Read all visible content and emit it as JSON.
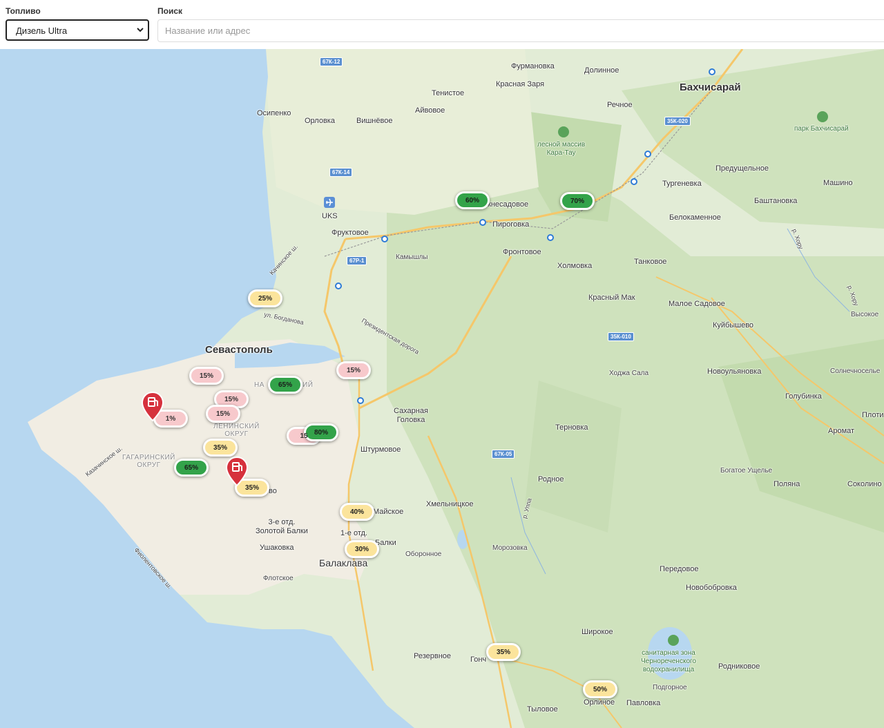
{
  "filters": {
    "fuel_label": "Топливо",
    "fuel_value": "Дизель Ultra",
    "search_label": "Поиск",
    "search_placeholder": "Название или адрес"
  },
  "map": {
    "places": {
      "furmanovka": "Фурмановка",
      "dolinnoe": "Долинное",
      "bakhchisaray": "Бахчисарай",
      "krasnaya_zarya": "Красная Заря",
      "tenistoe": "Тенистое",
      "rechnoe": "Речное",
      "osipenko": "Осипенко",
      "orlovka": "Орловка",
      "vishnevoe": "Вишнёвое",
      "aivovoe": "Айвовое",
      "park_bakhchisaray": "парк Бахчисарай",
      "kara_tau": "лесной массив\nКара-Тау",
      "predushchelnoe": "Предущельное",
      "turgenevka": "Тургеневка",
      "mashino": "Машино",
      "bashtanovka": "Баштановка",
      "uks": "UKS",
      "nesadovoe": "кнесадовое",
      "pirogovka": "Пироговка",
      "belokamennoe": "Белокаменное",
      "fruktovoe": "Фруктовое",
      "kamyshly": "Камышлы",
      "frontovoe": "Фронтовое",
      "kholmovka": "Холмовка",
      "tankovoe": "Танковое",
      "kachinskoe": "Качинское ш.",
      "krasny_mak": "Красный Мак",
      "maloe_sadovoe": "Малое Садовое",
      "vysokoe": "Высокое",
      "kuibyshevo": "Куйбышево",
      "bogdanova": "ул. Богданова",
      "prezidentskaya": "Президентская дорога",
      "sevastopol": "Севастополь",
      "khodzha_sala": "Ходжа Сала",
      "novoulyanovka": "Новоульяновка",
      "solnechnoselye": "Солнечноселье",
      "golubinka": "Голубинка",
      "plotinnoe": "Плоти",
      "sakharnaya": "Сахарная\nГоловка",
      "leninsky": "ЛЕНИНСКИЙ\nОКРУГ",
      "ternovka": "Терновка",
      "aromat": "Аромат",
      "shturmovoe": "Штурмовое",
      "gagarinsky": "ГАГАРИНСКИЙ\nОКРУГ",
      "kazachinskoe": "Казачинское ш.",
      "rodnoe": "Родное",
      "bogatoe_ushchelye": "Богатое Ущелье",
      "polyana": "Поляна",
      "sokolinoe": "Соколино",
      "khmelnitskoe": "Хмельницкое",
      "maiskoe": "Майское",
      "zolotoy_balki3": "3-е отд.\nЗолотой Балки",
      "otd1": "1-е отд.",
      "balki": "Балки",
      "ushakovka": "Ушаковка",
      "oboronnoe": "Оборонное",
      "morozovka": "Морозовка",
      "balaklava": "Балаклава",
      "flotskoe": "Флотское",
      "fiolentovskoe": "Фиолентовское ш.",
      "peredovoe": "Передовое",
      "novobobrovka": "Новобобровка",
      "shirokoe": "Широкое",
      "chernorech": "санитарная зона\nЧернореченского\nводохранилища",
      "rodnikovoe": "Родниковое",
      "rezervnoe": "Резервное",
      "gonchar": "Гонч",
      "podgornoe": "Подгорное",
      "orlinoe": "Орлиное",
      "pavlovka": "Павловка",
      "tylovoe": "Тыловое",
      "uppa": "р. Уппа",
      "khoru": "р. Хору",
      "khoru2": "р. Хору",
      "na": "НА",
      "iy": "ИЙ",
      "vo": "во"
    },
    "routes": {
      "r1": "67К-12",
      "r2": "67К-14",
      "r3": "67Р-1",
      "r4": "35К-020",
      "r5": "35К-010",
      "r6": "67К-05"
    },
    "badges": [
      {
        "label": "60%",
        "color": "green"
      },
      {
        "label": "70%",
        "color": "green"
      },
      {
        "label": "25%",
        "color": "yellow"
      },
      {
        "label": "15%",
        "color": "red"
      },
      {
        "label": "65%",
        "color": "green"
      },
      {
        "label": "15%",
        "color": "red"
      },
      {
        "label": "15%",
        "color": "red"
      },
      {
        "label": "15%",
        "color": "red"
      },
      {
        "label": "1%",
        "color": "red"
      },
      {
        "label": "15",
        "color": "red"
      },
      {
        "label": "80%",
        "color": "green"
      },
      {
        "label": "35%",
        "color": "yellow"
      },
      {
        "label": "65%",
        "color": "green"
      },
      {
        "label": "35%",
        "color": "yellow"
      },
      {
        "label": "40%",
        "color": "yellow"
      },
      {
        "label": "30%",
        "color": "yellow"
      },
      {
        "label": "35%",
        "color": "yellow"
      },
      {
        "label": "50%",
        "color": "yellow"
      }
    ],
    "colors": {
      "sea": "#b7d7f0",
      "land": "#e2ecd6",
      "forest": "#c9deb9",
      "city": "#f2eee4",
      "red": "#d6313d",
      "yellow": "#f0b923",
      "green": "#33a34a"
    }
  }
}
